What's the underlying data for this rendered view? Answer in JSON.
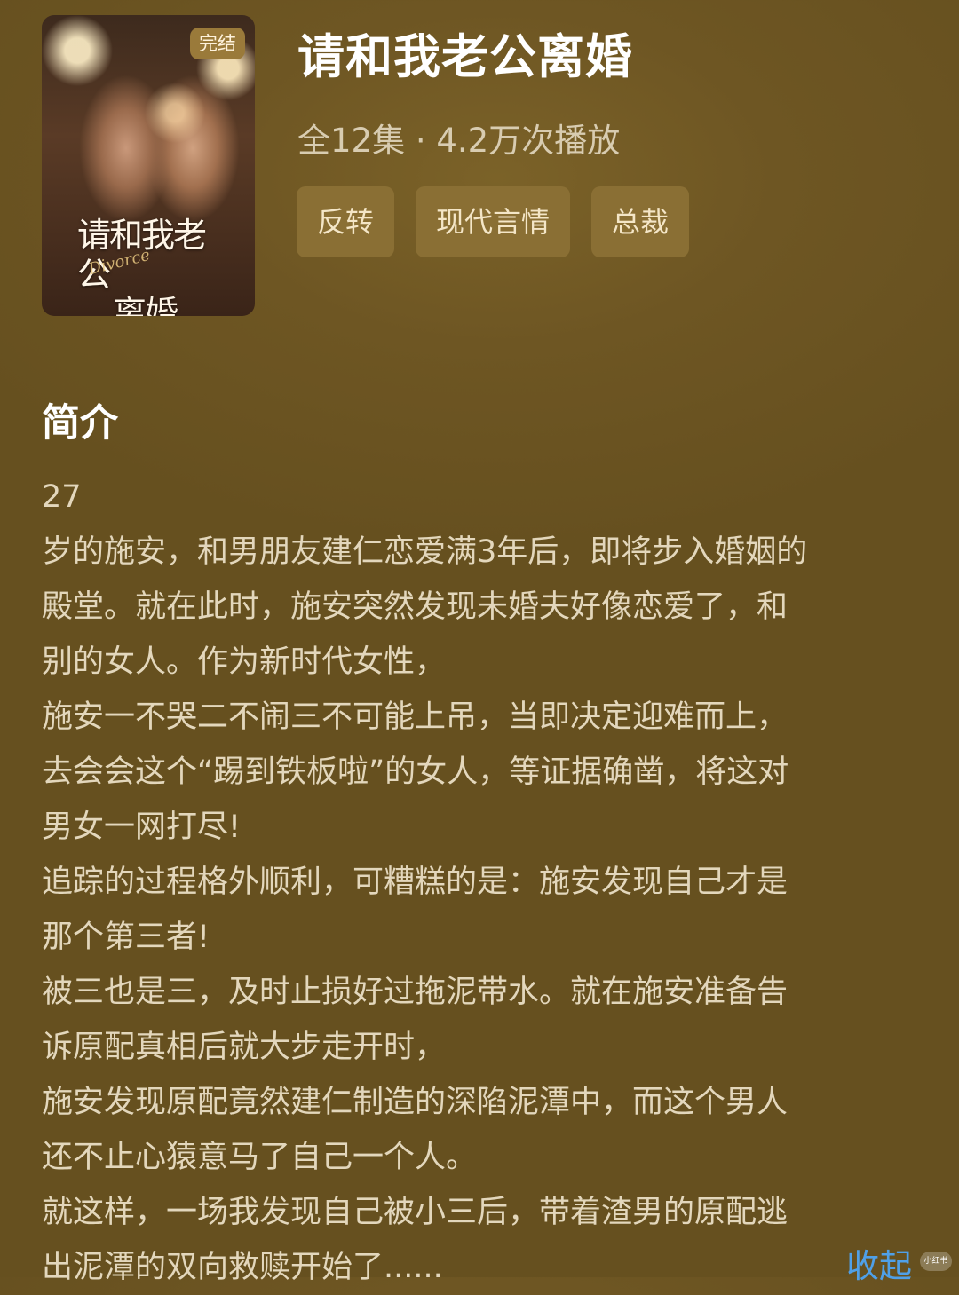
{
  "cover": {
    "badge": "完结",
    "art_title_lines": [
      "请和我老公",
      "离婚"
    ],
    "art_subtitle": "Divorce"
  },
  "header": {
    "title": "请和我老公离婚",
    "meta": "全12集 · 4.2万次播放",
    "tags": [
      "反转",
      "现代言情",
      "总裁"
    ]
  },
  "synopsis": {
    "heading": "简介",
    "lines": [
      "27",
      "岁的施安，和男朋友建仁恋爱满3年后，即将步入婚姻的",
      "殿堂。就在此时，施安突然发现未婚夫好像恋爱了，和",
      "别的女人。作为新时代女性，",
      "施安一不哭二不闹三不可能上吊，当即决定迎难而上，",
      "去会会这个“踢到铁板啦”的女人，等证据确凿，将这对",
      "男女一网打尽!",
      "追踪的过程格外顺利，可糟糕的是：施安发现自己才是",
      "那个第三者!",
      "被三也是三，及时止损好过拖泥带水。就在施安准备告",
      "诉原配真相后就大步走开时，",
      "施安发现原配竟然建仁制造的深陷泥潭中，而这个男人",
      "还不止心猿意马了自己一个人。",
      "就这样，一场我发现自己被小三后，带着渣男的原配逃",
      "出泥潭的双向救赎开始了......"
    ],
    "collapse_label": "收起"
  },
  "watermark": {
    "text": "小红书"
  },
  "colors": {
    "background": "#6b5322",
    "tag_bg": "#8a6f34",
    "link": "#4fa0e8"
  }
}
